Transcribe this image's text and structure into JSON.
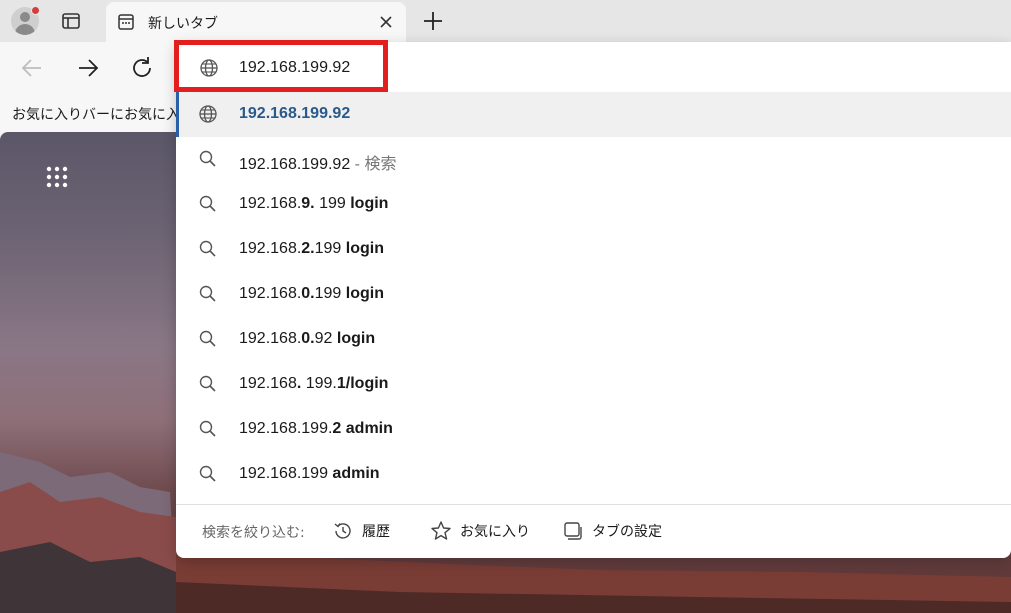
{
  "tab": {
    "title": "新しいタブ"
  },
  "favorites_bar": {
    "text": "お気に入りバーにお気に入り"
  },
  "address_bar": {
    "value": "192.168.199.92"
  },
  "suggestions": [
    {
      "type": "url",
      "text": "192.168.199.92"
    },
    {
      "type": "search",
      "main": "192.168.199.92",
      "suffix": " - 検索"
    },
    {
      "type": "search",
      "parts": [
        "192.168.",
        "9.",
        " 199 ",
        "login"
      ]
    },
    {
      "type": "search",
      "parts": [
        "192.168.",
        "2.",
        "199 ",
        "login"
      ]
    },
    {
      "type": "search",
      "parts": [
        "192.168.",
        "0.",
        "199 ",
        "login"
      ]
    },
    {
      "type": "search",
      "parts": [
        "192.168.",
        "0.",
        "92 ",
        "login"
      ]
    },
    {
      "type": "search",
      "parts": [
        "192.168",
        ". ",
        "199.",
        "1/login"
      ]
    },
    {
      "type": "search",
      "parts": [
        "192.168.199.",
        "2 admin",
        "",
        ""
      ]
    },
    {
      "type": "search",
      "parts": [
        "192.168.199 ",
        "admin",
        "",
        ""
      ]
    }
  ],
  "filters": {
    "label": "検索を絞り込む:",
    "history": "履歴",
    "favorites": "お気に入り",
    "tabs": "タブの設定"
  },
  "colors": {
    "highlight": "#e31e1e",
    "selected_bar": "#2b5fa6",
    "url_text": "#2a5a8a"
  }
}
